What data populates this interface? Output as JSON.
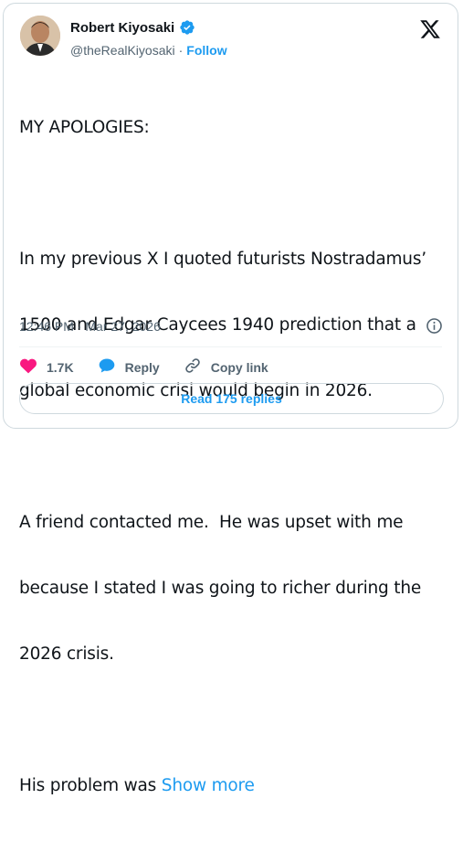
{
  "author": {
    "name": "Robert Kiyosaki",
    "handle": "@theRealKiyosaki",
    "separator": "·",
    "follow_label": "Follow"
  },
  "tweet": {
    "lines": [
      "MY APOLOGIES:",
      "",
      "In my previous X I quoted futurists Nostradamus’",
      "1500 and Edgar Caycees 1940 prediction that a",
      "global economic crisi would begin in 2026.",
      "",
      "A friend contacted me.  He was upset with me",
      "because I stated I was going to richer during the",
      "2026 crisis.",
      ""
    ],
    "last_line_prefix": "His problem was ",
    "show_more_label": "Show more",
    "timestamp": "12:46 PM · Mar 27, 2026"
  },
  "actions": {
    "likes": "1.7K",
    "reply_label": "Reply",
    "copy_label": "Copy link"
  },
  "read_replies_label": "Read 175 replies",
  "colors": {
    "accent": "#1d9bf0",
    "like": "#f91880",
    "muted": "#536471"
  },
  "icons": [
    "verified-badge-icon",
    "x-logo-icon",
    "info-icon",
    "heart-icon",
    "reply-icon",
    "link-icon"
  ]
}
